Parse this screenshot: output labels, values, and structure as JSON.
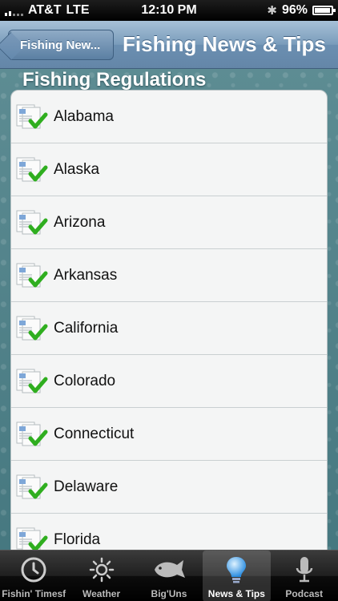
{
  "status_bar": {
    "carrier": "AT&T",
    "network": "LTE",
    "time": "12:10 PM",
    "battery": "96%",
    "battery_level": 0.96
  },
  "nav_bar": {
    "back_label": "Fishing New...",
    "title": "Fishing News & Tips"
  },
  "section": {
    "header": "Fishing Regulations"
  },
  "list": {
    "items": [
      {
        "label": "Alabama"
      },
      {
        "label": "Alaska"
      },
      {
        "label": "Arizona"
      },
      {
        "label": "Arkansas"
      },
      {
        "label": "California"
      },
      {
        "label": "Colorado"
      },
      {
        "label": "Connecticut"
      },
      {
        "label": "Delaware"
      },
      {
        "label": "Florida"
      }
    ],
    "icon": "document-checkmark-icon"
  },
  "tab_bar": {
    "tabs": [
      {
        "label": "Fishin' Timesf",
        "icon": "clock-icon"
      },
      {
        "label": "Weather",
        "icon": "sun-icon"
      },
      {
        "label": "Big'Uns",
        "icon": "fish-icon"
      },
      {
        "label": "News & Tips",
        "icon": "lightbulb-icon"
      },
      {
        "label": "Podcast",
        "icon": "microphone-icon"
      }
    ],
    "selected_index": 3
  },
  "colors": {
    "nav_bar": "#7a9cbb",
    "checkmark": "#2fae1f",
    "tab_bar": "#1f1f1f"
  }
}
